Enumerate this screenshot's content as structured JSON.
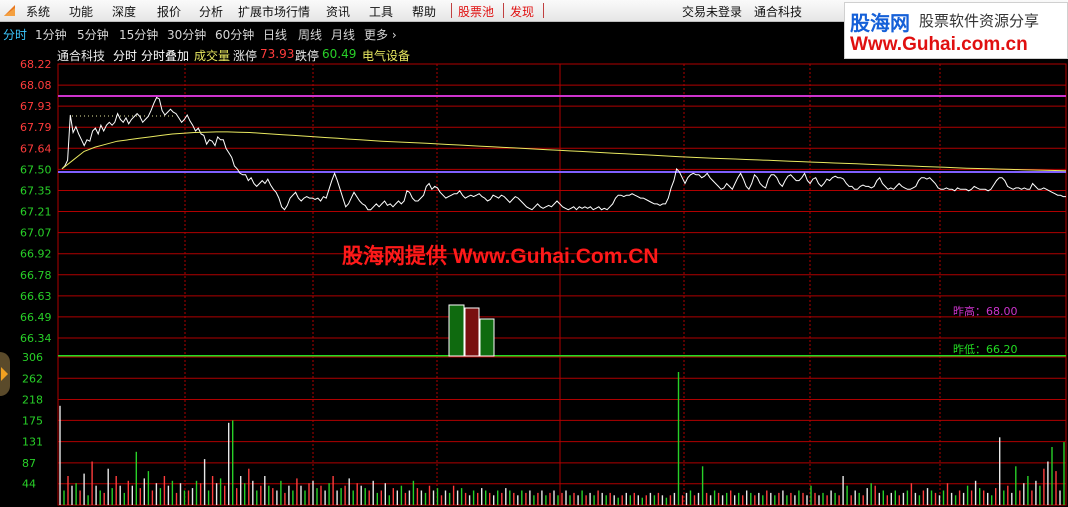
{
  "menu": {
    "items": [
      "系统",
      "功能",
      "深度",
      "报价",
      "分析",
      "扩展市场行情",
      "资讯",
      "工具",
      "帮助"
    ],
    "hot_items": [
      "股票池",
      "发现"
    ],
    "login_status": "交易未登录",
    "company": "通合科技"
  },
  "tabs": {
    "items": [
      "分时",
      "1分钟",
      "5分钟",
      "15分钟",
      "30分钟",
      "60分钟",
      "日线",
      "周线",
      "月线",
      "更多"
    ],
    "active": "分时"
  },
  "info": {
    "stock_name": "通合科技",
    "mode1": "分时",
    "mode2": "分时叠加",
    "volume_label": "成交量",
    "limit_up_label": "涨停",
    "limit_up_value": "73.93",
    "limit_down_label": "跌停",
    "limit_down_value": "60.49",
    "sector": "电气设备"
  },
  "logo": {
    "line1": "股海网",
    "line1b": "股票软件资源分享",
    "line2": "Www.Guhai.com.cn"
  },
  "watermark": "股海网提供 Www.Guhai.Com.CN",
  "colors": {
    "price_line": "#ffffff",
    "avg_line": "#e8e860",
    "grid": "#b00000",
    "axis_up": "#ff3c3c",
    "axis_down": "#28d028",
    "prev_high": "#cc33cc",
    "prev_low": "#22dd22",
    "base_line": "#7f5fff"
  },
  "chart_data": [
    {
      "type": "line",
      "title": "通合科技 分时",
      "y_ticks": [
        "68.22",
        "68.08",
        "67.93",
        "67.79",
        "67.64",
        "67.50",
        "67.35",
        "67.21",
        "67.07",
        "66.92",
        "66.78",
        "66.63",
        "66.49",
        "66.34"
      ],
      "ylim": [
        66.34,
        68.22
      ],
      "prev_close": 67.5,
      "grid": true,
      "annotations": [
        {
          "label": "昨高",
          "value": "68.00"
        },
        {
          "label": "昨低",
          "value": "66.20"
        }
      ],
      "series": [
        {
          "name": "price",
          "values": [
            67.5,
            67.52,
            67.56,
            67.87,
            67.75,
            67.79,
            67.74,
            67.7,
            67.66,
            67.7,
            67.69,
            67.76,
            67.78,
            67.74,
            67.8,
            67.76,
            67.8,
            67.82,
            67.8,
            67.82,
            67.88,
            67.84,
            67.82,
            67.85,
            67.81,
            67.84,
            67.86,
            67.88,
            67.86,
            67.82,
            67.84,
            67.86,
            67.9,
            67.95,
            67.99,
            67.98,
            67.9,
            67.87,
            67.89,
            67.91,
            67.89,
            67.88,
            67.85,
            67.82,
            67.84,
            67.87,
            67.83,
            67.8,
            67.76,
            67.78,
            67.74,
            67.73,
            67.67,
            67.7,
            67.69,
            67.66,
            67.72,
            67.7,
            67.7,
            67.64,
            67.61,
            67.58,
            67.52,
            67.5,
            67.47,
            67.46,
            67.46,
            67.42,
            67.44,
            67.4,
            67.38,
            67.4,
            67.42,
            67.4,
            67.43,
            67.39,
            67.36,
            67.34,
            67.3,
            67.24,
            67.22,
            67.25,
            67.3,
            67.32,
            67.34,
            67.3,
            67.28,
            67.3,
            67.31,
            67.3,
            67.3,
            67.29,
            67.3,
            67.28,
            67.31,
            67.3,
            67.36,
            67.42,
            67.47,
            67.42,
            67.36,
            67.3,
            67.24,
            67.26,
            67.3,
            67.34,
            67.31,
            67.28,
            67.26,
            67.25,
            67.22,
            67.22,
            67.24,
            67.26,
            67.24,
            67.26,
            67.28,
            67.25,
            67.26,
            67.24,
            67.26,
            67.28,
            67.26,
            67.28,
            67.35,
            67.34,
            67.3,
            67.28,
            67.28,
            67.3,
            67.32,
            67.38,
            67.4,
            67.36,
            67.38,
            67.37,
            67.34,
            67.32,
            67.3,
            67.31,
            67.32,
            67.33,
            67.33,
            67.35,
            67.32,
            67.3,
            67.31,
            67.32,
            67.31,
            67.32,
            67.33,
            67.31,
            67.3,
            67.28,
            67.29,
            67.32,
            67.31,
            67.3,
            67.32,
            67.31,
            67.29,
            67.27,
            67.29,
            67.31,
            67.3,
            67.28,
            67.26,
            67.24,
            67.23,
            67.22,
            67.24,
            67.26,
            67.24,
            67.23,
            67.24,
            67.25,
            67.24,
            67.26,
            67.28,
            67.26,
            67.24,
            67.23,
            67.22,
            67.23,
            67.24,
            67.22,
            67.24,
            67.23,
            67.24,
            67.23,
            67.24,
            67.22,
            67.23,
            67.24,
            67.22,
            67.23,
            67.22,
            67.24,
            67.26,
            67.3,
            67.32,
            67.32,
            67.31,
            67.32,
            67.32,
            67.33,
            67.32,
            67.31,
            67.3,
            67.3,
            67.29,
            67.28,
            67.27,
            67.26,
            67.26,
            67.25,
            67.26,
            67.26,
            67.3,
            67.37,
            67.42,
            67.5,
            67.48,
            67.44,
            67.4,
            67.44,
            67.46,
            67.47,
            67.46,
            67.46,
            67.44,
            67.45,
            67.47,
            67.44,
            67.42,
            67.4,
            67.38,
            67.36,
            67.37,
            67.4,
            67.38,
            67.36,
            67.4,
            67.44,
            67.47,
            67.43,
            67.38,
            67.36,
            67.4,
            67.46,
            67.44,
            67.4,
            67.38,
            67.37,
            67.43,
            67.46,
            67.46,
            67.44,
            67.4,
            67.38,
            67.42,
            67.45,
            67.46,
            67.44,
            67.42,
            67.42,
            67.44,
            67.47,
            67.42,
            67.4,
            67.43,
            67.44,
            67.4,
            67.38,
            67.4,
            67.43,
            67.42,
            67.44,
            67.45,
            67.44,
            67.44,
            67.43,
            67.4,
            67.38,
            67.38,
            67.36,
            67.36,
            67.38,
            67.39,
            67.38,
            67.38,
            67.37,
            67.38,
            67.42,
            67.44,
            67.4,
            67.38,
            67.36,
            67.37,
            67.36,
            67.38,
            67.4,
            67.38,
            67.37,
            67.36,
            67.36,
            67.37,
            67.38,
            67.42,
            67.44,
            67.44,
            67.43,
            67.44,
            67.42,
            67.4,
            67.37,
            67.36,
            67.36,
            67.37,
            67.36,
            67.36,
            67.35,
            67.37,
            67.36,
            67.36,
            67.36,
            67.35,
            67.36,
            67.38,
            67.37,
            67.36,
            67.36,
            67.36,
            67.35,
            67.36,
            67.39,
            67.42,
            67.44,
            67.44,
            67.42,
            67.38,
            67.37,
            67.36,
            67.37,
            67.37,
            67.36,
            67.37,
            67.36,
            67.36,
            67.4,
            67.38,
            67.36,
            67.36,
            67.37,
            67.36,
            67.35,
            67.34,
            67.33,
            67.32,
            67.32,
            67.31,
            67.31
          ]
        },
        {
          "name": "average",
          "values": [
            67.5,
            67.56,
            67.62,
            67.65,
            67.67,
            67.69,
            67.7,
            67.71,
            67.72,
            67.73,
            67.74,
            67.745,
            67.75,
            67.752,
            67.754,
            67.754,
            67.752,
            67.75,
            67.745,
            67.74,
            67.735,
            67.73,
            67.725,
            67.72,
            67.715,
            67.71,
            67.705,
            67.7,
            67.695,
            67.69,
            67.686,
            67.683,
            67.68,
            67.676,
            67.672,
            67.668,
            67.664,
            67.66,
            67.656,
            67.652,
            67.648,
            67.644,
            67.64,
            67.636,
            67.632,
            67.628,
            67.624,
            67.62,
            67.616,
            67.612,
            67.608,
            67.604,
            67.6,
            67.596,
            67.592,
            67.588,
            67.584,
            67.58,
            67.577,
            67.574,
            67.571,
            67.568,
            67.565,
            67.562,
            67.559,
            67.556,
            67.553,
            67.55,
            67.547,
            67.544,
            67.541,
            67.538,
            67.535,
            67.532,
            67.529,
            67.526,
            67.523,
            67.52,
            67.517,
            67.514,
            67.511,
            67.508,
            67.505,
            67.503,
            67.501,
            67.499,
            67.497,
            67.495,
            67.493,
            67.491,
            67.489,
            67.487
          ]
        }
      ]
    },
    {
      "type": "bar",
      "title": "成交量",
      "y_ticks": [
        "306",
        "262",
        "218",
        "175",
        "131",
        "87",
        "44"
      ],
      "ylim": [
        0,
        306
      ],
      "values": [
        205,
        30,
        60,
        40,
        45,
        30,
        65,
        20,
        90,
        40,
        30,
        25,
        75,
        35,
        60,
        40,
        25,
        50,
        40,
        110,
        35,
        55,
        70,
        30,
        45,
        35,
        60,
        40,
        50,
        25,
        45,
        30,
        30,
        35,
        50,
        45,
        95,
        30,
        60,
        45,
        55,
        40,
        170,
        175,
        35,
        60,
        45,
        75,
        50,
        30,
        40,
        60,
        40,
        35,
        30,
        50,
        25,
        40,
        30,
        55,
        40,
        30,
        45,
        50,
        35,
        40,
        30,
        45,
        60,
        30,
        35,
        40,
        55,
        30,
        45,
        40,
        35,
        30,
        50,
        25,
        30,
        45,
        20,
        35,
        30,
        40,
        25,
        30,
        50,
        35,
        30,
        25,
        40,
        30,
        35,
        20,
        30,
        25,
        40,
        30,
        35,
        25,
        20,
        30,
        25,
        35,
        30,
        25,
        20,
        30,
        25,
        35,
        30,
        25,
        20,
        30,
        25,
        30,
        20,
        25,
        30,
        20,
        25,
        30,
        20,
        25,
        30,
        20,
        25,
        20,
        30,
        20,
        25,
        20,
        30,
        25,
        20,
        25,
        20,
        15,
        20,
        25,
        20,
        25,
        20,
        15,
        20,
        25,
        20,
        25,
        20,
        15,
        20,
        25,
        275,
        20,
        25,
        30,
        20,
        25,
        80,
        25,
        20,
        30,
        25,
        20,
        25,
        30,
        20,
        25,
        20,
        30,
        25,
        20,
        25,
        20,
        30,
        25,
        20,
        25,
        30,
        20,
        25,
        20,
        30,
        25,
        20,
        40,
        25,
        20,
        25,
        20,
        30,
        25,
        20,
        60,
        40,
        20,
        30,
        25,
        20,
        35,
        45,
        40,
        25,
        30,
        20,
        25,
        30,
        20,
        25,
        30,
        45,
        25,
        20,
        30,
        35,
        30,
        25,
        20,
        30,
        45,
        25,
        20,
        30,
        25,
        40,
        30,
        50,
        35,
        30,
        25,
        20,
        35,
        140,
        30,
        40,
        25,
        80,
        30,
        45,
        60,
        30,
        50,
        40,
        75,
        90,
        120,
        70,
        30,
        130
      ]
    }
  ]
}
